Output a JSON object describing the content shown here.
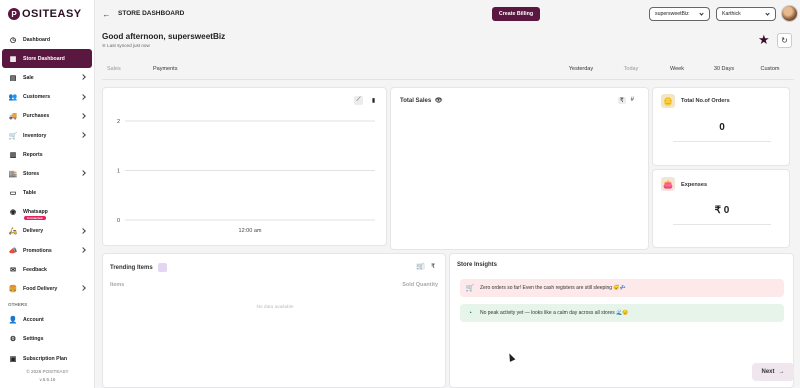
{
  "brand": {
    "logo_letter": "P",
    "name": "OSITEASY"
  },
  "sidebar": {
    "items": [
      {
        "label": "Dashboard",
        "icon": "dashboard-icon",
        "chevron": false,
        "active": false
      },
      {
        "label": "Store Dashboard",
        "icon": "store-dashboard-icon",
        "chevron": false,
        "active": true
      },
      {
        "label": "Sale",
        "icon": "sale-icon",
        "chevron": true
      },
      {
        "label": "Customers",
        "icon": "customers-icon",
        "chevron": true
      },
      {
        "label": "Purchases",
        "icon": "truck-icon",
        "chevron": true
      },
      {
        "label": "Inventory",
        "icon": "cart-icon",
        "chevron": true
      },
      {
        "label": "Reports",
        "icon": "reports-icon",
        "chevron": false
      },
      {
        "label": "Stores",
        "icon": "store-icon",
        "chevron": true
      },
      {
        "label": "Table",
        "icon": "table-icon",
        "chevron": false
      },
      {
        "label": "Whatsapp",
        "icon": "whatsapp-icon",
        "chevron": false,
        "badge": "Connected"
      },
      {
        "label": "Delivery",
        "icon": "delivery-icon",
        "chevron": true
      },
      {
        "label": "Promotions",
        "icon": "promotions-icon",
        "chevron": true
      },
      {
        "label": "Feedback",
        "icon": "feedback-icon",
        "chevron": false
      },
      {
        "label": "Food Delivery",
        "icon": "food-delivery-icon",
        "chevron": true
      }
    ],
    "others_label": "OTHERS",
    "others": [
      {
        "label": "Account",
        "icon": "account-icon"
      },
      {
        "label": "Settings",
        "icon": "settings-icon"
      },
      {
        "label": "Subscription Plan",
        "icon": "subscription-icon"
      }
    ],
    "footer_copyright": "© 2026 POSITEASY",
    "footer_version": "v.5.6.16"
  },
  "header": {
    "title": "STORE DASHBOARD",
    "create_billing": "Create Billing",
    "business_select": "supersweetBiz",
    "user_select": "Karthick"
  },
  "greeting": "Good afternoon, supersweetBiz",
  "synced": "Last synced just now",
  "tabs_left": [
    "Sales",
    "Payments"
  ],
  "tabs_right": [
    "Yesterday",
    "Today",
    "Week",
    "30 Days",
    "Custom"
  ],
  "chart_data": {
    "type": "line",
    "x": [
      "12:00 am"
    ],
    "series": [],
    "yticks": [
      "2",
      "1",
      "0"
    ],
    "ylim": [
      0,
      2
    ]
  },
  "total_sales": {
    "title": "Total Sales",
    "currency_icon": "₹",
    "count_icon": "#"
  },
  "total_orders": {
    "title": "Total No.of Orders",
    "value": "0"
  },
  "expenses": {
    "title": "Expenses",
    "value": "₹ 0"
  },
  "trending": {
    "title": "Trending Items",
    "col_items": "Items",
    "col_qty": "Sold Quantity",
    "empty": "No data available"
  },
  "insights": {
    "title": "Store Insights",
    "items": [
      {
        "text": "Zero orders so far! Even the cash registers are still sleeping 😴💤",
        "color": "#fde8ea",
        "icon": "🛒"
      },
      {
        "text": "No peak activity yet — looks like a calm day across all stores 🌊😌",
        "color": "#e6f4ea",
        "icon": "◔"
      }
    ]
  },
  "next_label": "Next",
  "colors": {
    "brand": "#5a1840"
  }
}
